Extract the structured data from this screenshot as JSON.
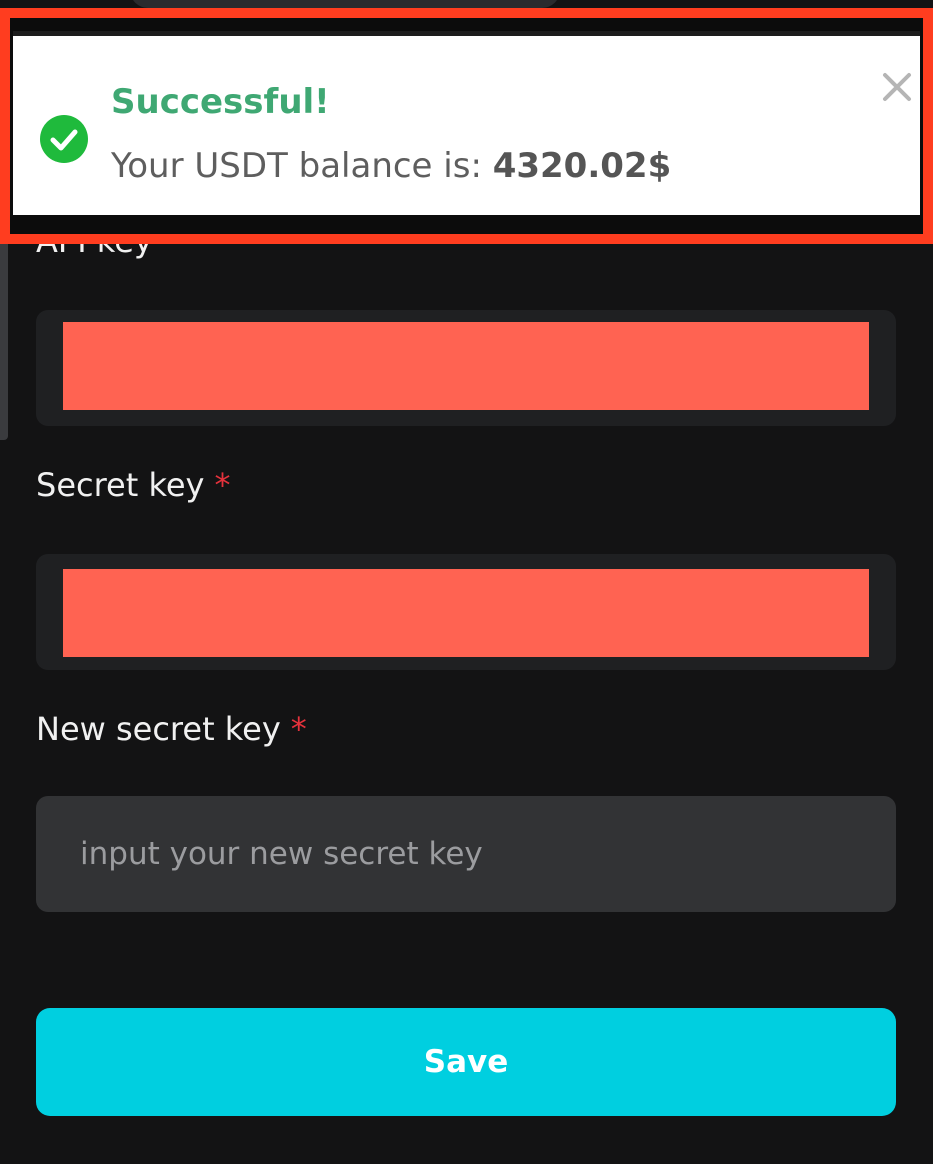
{
  "toast": {
    "title": "Successful!",
    "message_prefix": "Your USDT balance is: ",
    "amount": "4320.02$",
    "status_color": "#1fba3c",
    "highlight_border_color": "#ff3d1f"
  },
  "form": {
    "api_key": {
      "label": "API key",
      "required_mark": "*"
    },
    "secret_key": {
      "label": "Secret key",
      "required_mark": "*"
    },
    "new_secret_key": {
      "label": "New secret key",
      "required_mark": "*",
      "placeholder": "input your new secret key"
    },
    "redaction_color": "#ff6352",
    "save_label": "Save",
    "save_color": "#00cfe0"
  }
}
